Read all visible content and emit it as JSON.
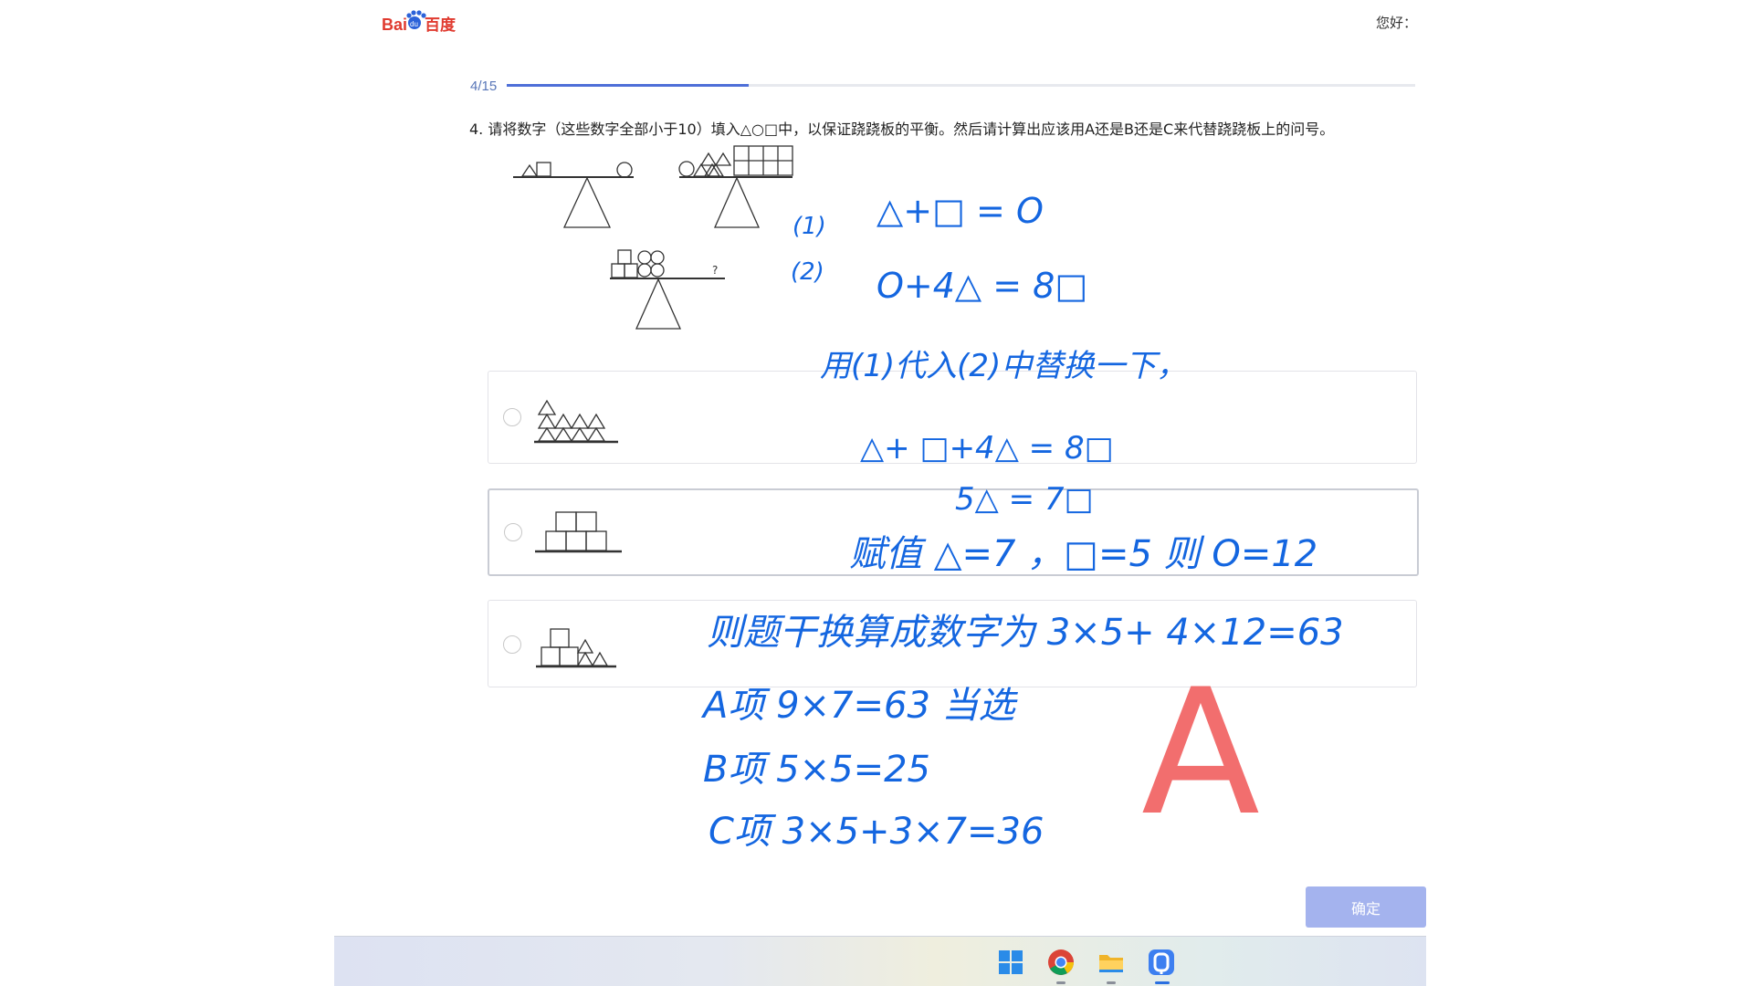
{
  "header": {
    "logo_text": "Bai百度",
    "greeting": "您好："
  },
  "progress": {
    "label": "4/15",
    "current": 4,
    "total": 15
  },
  "question": {
    "text": "4. 请将数字（这些数字全部小于10）填入△○□中，以保证跷跷板的平衡。然后请计算出应该用A还是B还是C来代替跷跷板上的问号。",
    "unknown_mark": "?"
  },
  "options": [
    {
      "id": "A",
      "selected": false
    },
    {
      "id": "B",
      "selected": true
    },
    {
      "id": "C",
      "selected": false
    }
  ],
  "confirm_label": "确定",
  "taskbar": {
    "icons": [
      "windows-start-icon",
      "chrome-icon",
      "file-explorer-icon",
      "app-icon"
    ]
  },
  "handwriting": {
    "l1_num": "(1)",
    "l1": "△+□ = O",
    "l2_num": "(2)",
    "l2": "O+4△ = 8□",
    "note": "用(1)代入(2)中替换一下，",
    "l3": "△+ □+4△ = 8□",
    "l4": "5△ = 7□",
    "l5": "赋值 △=7 ，□=5 则 O=12",
    "l6": "则题干换算成数字为 3×5+ 4×12=63",
    "a": "A项   9×7=63 当选",
    "b": "B项   5×5=25",
    "c": "C项   3×5+3×7=36",
    "answer": "A"
  },
  "colors": {
    "ink_blue": "#1466e0",
    "ink_red": "#f05a5a",
    "progress": "#4e6fd8",
    "button": "#a4b3ee"
  }
}
